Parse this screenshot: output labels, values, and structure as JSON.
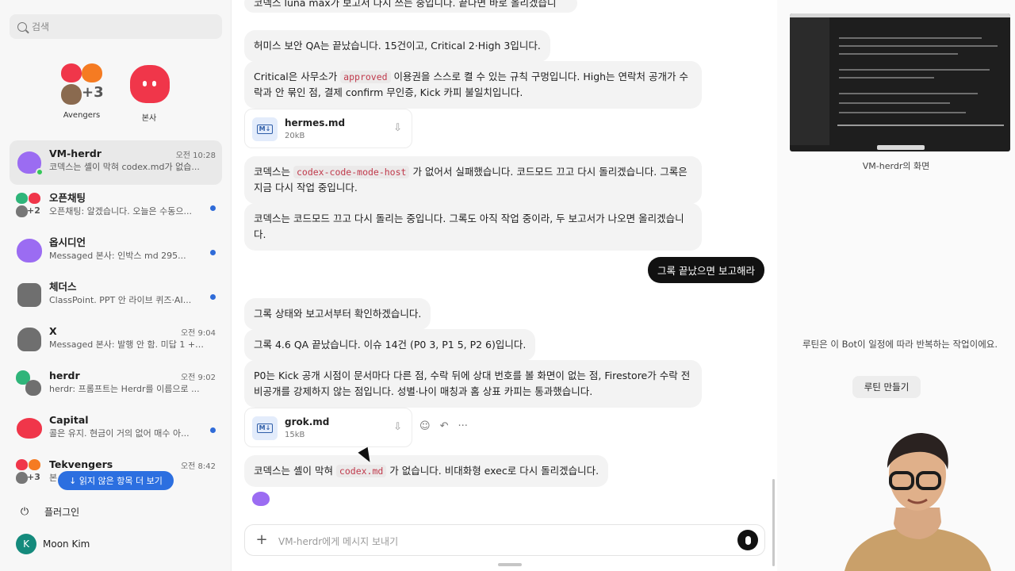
{
  "sidebar": {
    "search_placeholder": "검색",
    "pinned": [
      {
        "label": "Avengers",
        "extra": "+3"
      },
      {
        "label": "본사"
      }
    ],
    "chats": [
      {
        "name": "VM-herdr",
        "preview": "코덱스는 셸이 막혀 codex.md가 없습...",
        "time": "오전 10:28"
      },
      {
        "name": "오픈채팅",
        "preview": "오픈채팅: 알겠습니다. 오늘은 수동으...",
        "extra": "+2"
      },
      {
        "name": "옵시디언",
        "preview": "Messaged 본사: 인박스 md 295..."
      },
      {
        "name": "체더스",
        "preview": "ClassPoint. PPT 안 라이브 퀴즈·AI..."
      },
      {
        "name": "X",
        "preview": "Messaged 본사: 발행 안 함. 미답 1 + ...",
        "time": "오전 9:04"
      },
      {
        "name": "herdr",
        "preview": "herdr: 프롬프트는 Herdr를 이름으로 ...",
        "time": "오전 9:02"
      },
      {
        "name": "Capital",
        "preview": "콜은 유지. 현금이 거의 없어 매수 아..."
      },
      {
        "name": "Tekvengers",
        "preview": "본... 대구 6...",
        "time": "오전 8:42",
        "extra": "+3"
      }
    ],
    "unread_button": "↓ 읽지 않은 항목 더 보기",
    "plugins_label": "플러그인",
    "user_initial": "K",
    "user_name": "Moon Kim"
  },
  "chat": {
    "partial_top": "코덱스 luna max가 보고서 다시 쓰는 중입니다. 끝나면 바로 올리겠습니다.",
    "messages": [
      {
        "text": "허미스 보안 QA는 끝났습니다. 15건이고, Critical 2·High 3입니다."
      },
      {
        "pre": "Critical은 사무소가 ",
        "code": "approved",
        "post": " 이용권을 스스로 켤 수 있는 규칙 구멍입니다. High는 연락처 공개가 수락과 안 묶인 점, 결제 confirm 무인증, Kick 카피 불일치입니다."
      },
      {
        "pre": "코덱스는 ",
        "code": "codex-code-mode-host",
        "post": " 가 없어서 실패했습니다. 코드모드 끄고 다시 돌리겠습니다. 그록은 지금 다시 작업 중입니다."
      },
      {
        "text": "코덱스는 코드모드 끄고 다시 돌리는 중입니다. 그록도 아직 작업 중이라, 두 보고서가 나오면 올리겠습니다."
      },
      {
        "text": "그록 상태와 보고서부터 확인하겠습니다."
      },
      {
        "text": "그록 4.6 QA 끝났습니다. 이슈 14건 (P0 3, P1 5, P2 6)입니다."
      },
      {
        "text": "P0는 Kick 공개 시점이 문서마다 다른 점, 수락 뒤에 상대 번호를 볼 화면이 없는 점, Firestore가 수락 전 비공개를 강제하지 않는 점입니다. 성별·나이 매칭과 홈 상표 카피는 통과했습니다."
      },
      {
        "pre": "코덱스는 셸이 막혀 ",
        "code": "codex.md",
        "post": " 가 없습니다. 비대화형 exec로 다시 돌리겠습니다."
      }
    ],
    "files": [
      {
        "name": "hermes.md",
        "size": "20kB",
        "badge": "M↓"
      },
      {
        "name": "grok.md",
        "size": "15kB",
        "badge": "M↓"
      }
    ],
    "sent_message": "그록 끝났으면 보고해라",
    "composer_placeholder": "VM-herdr에게 메시지 보내기"
  },
  "right_panel": {
    "screen_caption": "VM-herdr의 화면",
    "routine_text": "루틴은 이 Bot이 일정에 따라 반복하는 작업이에요.",
    "routine_button": "루틴 만들기"
  },
  "colors": {
    "accent": "#2c6fe0",
    "code_text": "#c0394b",
    "red_avatar": "#f0364a",
    "purple_avatar": "#9b6cf2"
  }
}
